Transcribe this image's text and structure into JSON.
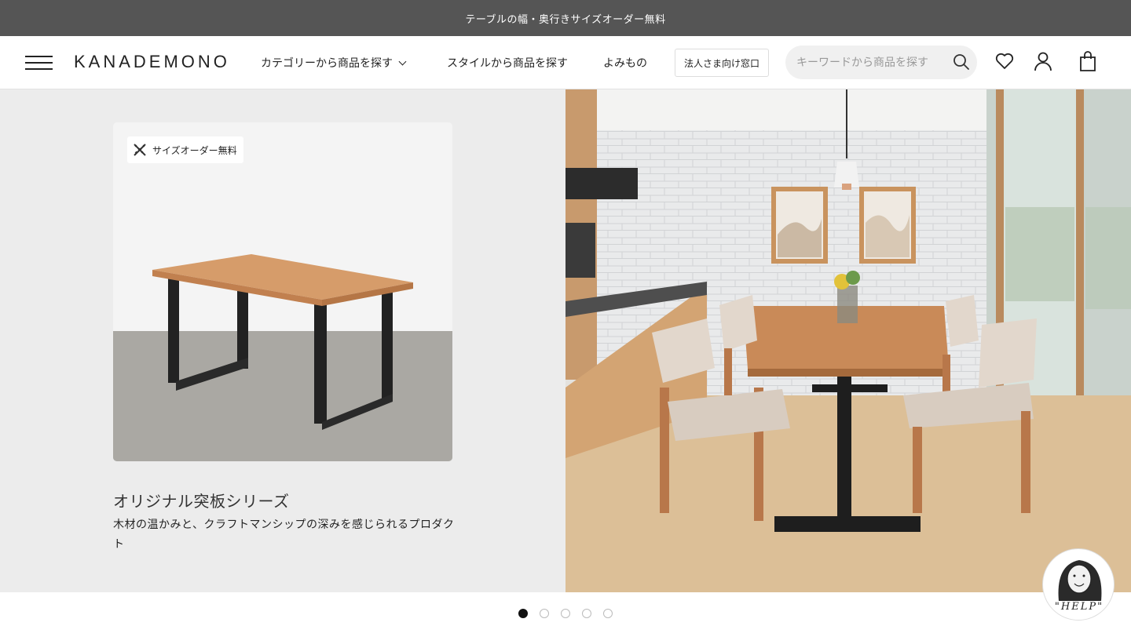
{
  "announcement": "テーブルの幅・奥行きサイズオーダー無料",
  "header": {
    "logo": "KANADEMONO",
    "nav": [
      {
        "label": "カテゴリーから商品を探す"
      },
      {
        "label": "スタイルから商品を探す"
      },
      {
        "label": "よみもの"
      }
    ],
    "corporate_button": "法人さま向け窓口",
    "search_placeholder": "キーワードから商品を探す",
    "icons": [
      "menu-icon",
      "search-icon",
      "heart-icon",
      "user-icon",
      "bag-icon"
    ]
  },
  "hero": {
    "badge": "サイズオーダー無料",
    "badge_icon": "ruler-cross-icon",
    "title": "オリジナル突板シリーズ",
    "description": "木材の温かみと、クラフトマンシップの深みを感じられるプロダクト",
    "left_bg": "#ececec"
  },
  "carousel": {
    "count": 5,
    "active": 1
  },
  "help": {
    "label": "\"HELP\""
  },
  "colors": {
    "announce_bg": "#555555",
    "wood": "#d19a69",
    "steel": "#222222"
  }
}
